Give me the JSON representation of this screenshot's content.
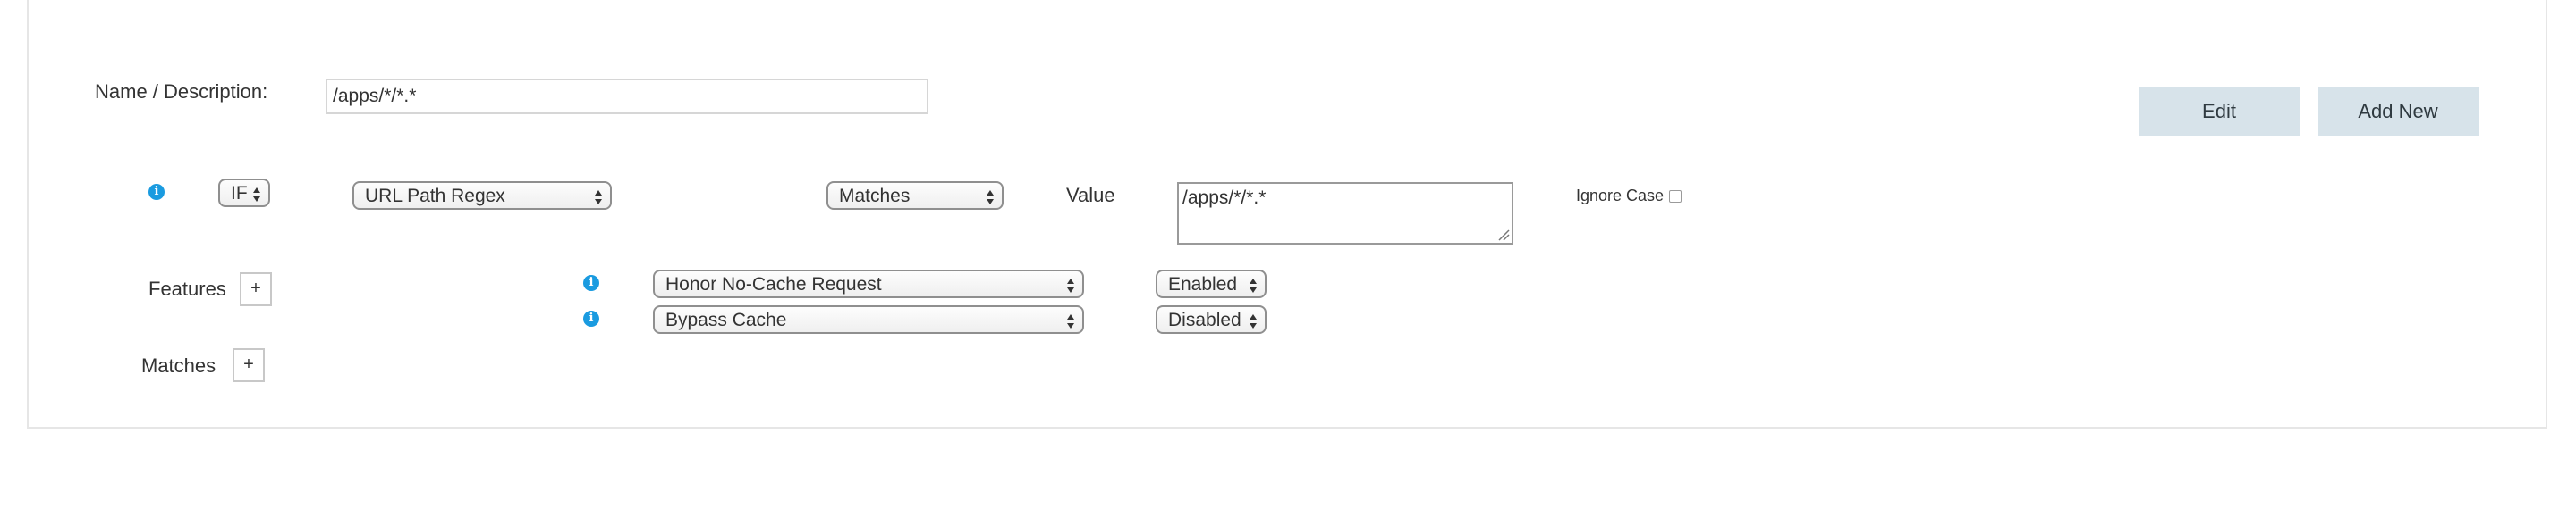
{
  "name_row": {
    "label": "Name / Description:",
    "value": "/apps/*/*.*"
  },
  "buttons": {
    "edit": "Edit",
    "add_new": "Add New"
  },
  "condition": {
    "info_icon": "info-icon",
    "operator": "IF",
    "match_type": "URL Path Regex",
    "comparison": "Matches",
    "value_label": "Value",
    "value": "/apps/*/*.*",
    "ignore_case_label": "Ignore Case",
    "ignore_case_checked": false
  },
  "features": {
    "label": "Features",
    "add_label": "+",
    "items": [
      {
        "info_icon": "info-icon",
        "feature": "Honor No-Cache Request",
        "state": "Enabled"
      },
      {
        "info_icon": "info-icon",
        "feature": "Bypass Cache",
        "state": "Disabled"
      }
    ]
  },
  "matches": {
    "label": "Matches",
    "add_label": "+"
  },
  "colors": {
    "button_bg": "#d7e3ea",
    "info_icon": "#1a9be0"
  }
}
